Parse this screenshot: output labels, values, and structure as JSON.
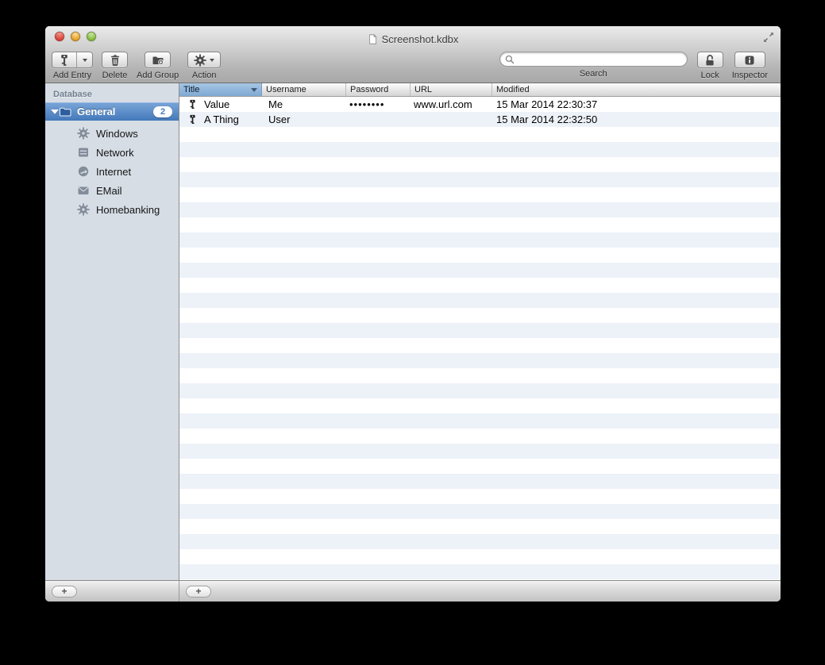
{
  "window": {
    "title": "Screenshot.kdbx"
  },
  "toolbar": {
    "add_entry_label": "Add Entry",
    "delete_label": "Delete",
    "add_group_label": "Add Group",
    "action_label": "Action",
    "search_label": "Search",
    "search_value": "",
    "search_placeholder": "",
    "lock_label": "Lock",
    "inspector_label": "Inspector",
    "icons": [
      "key-icon",
      "trash-icon",
      "add-folder-icon",
      "gear-icon",
      "magnifier-icon",
      "open-padlock-icon",
      "info-icon",
      "fullscreen-icon"
    ]
  },
  "sidebar": {
    "header": "Database",
    "root": {
      "label": "General",
      "badge": "2",
      "icon": "folder-icon",
      "expanded": true
    },
    "items": [
      {
        "label": "Windows",
        "icon": "gear-icon"
      },
      {
        "label": "Network",
        "icon": "server-icon"
      },
      {
        "label": "Internet",
        "icon": "globe-icon"
      },
      {
        "label": "EMail",
        "icon": "envelope-icon"
      },
      {
        "label": "Homebanking",
        "icon": "gear-icon"
      }
    ],
    "add_button": "+"
  },
  "table": {
    "columns": [
      "Title",
      "Username",
      "Password",
      "URL",
      "Modified"
    ],
    "sorted_column": "Title",
    "sort_direction": "desc",
    "rows": [
      {
        "icon": "key-icon",
        "title": "Value",
        "username": "Me",
        "password": "••••••••",
        "url": "www.url.com",
        "modified": "15 Mar 2014 22:30:37"
      },
      {
        "icon": "key-icon",
        "title": "A Thing",
        "username": "User",
        "password": "",
        "url": "",
        "modified": "15 Mar 2014 22:32:50"
      }
    ],
    "add_button": "+"
  },
  "colors": {
    "selection_blue_top": "#7aa6d8",
    "selection_blue_bottom": "#4378ba",
    "sorted_header_top": "#a6c6e4",
    "sorted_header_bottom": "#7fa9d3",
    "row_stripe": "#edf2f8",
    "sidebar_bg": "#d6dde5",
    "desktop_bg": "#000000"
  }
}
